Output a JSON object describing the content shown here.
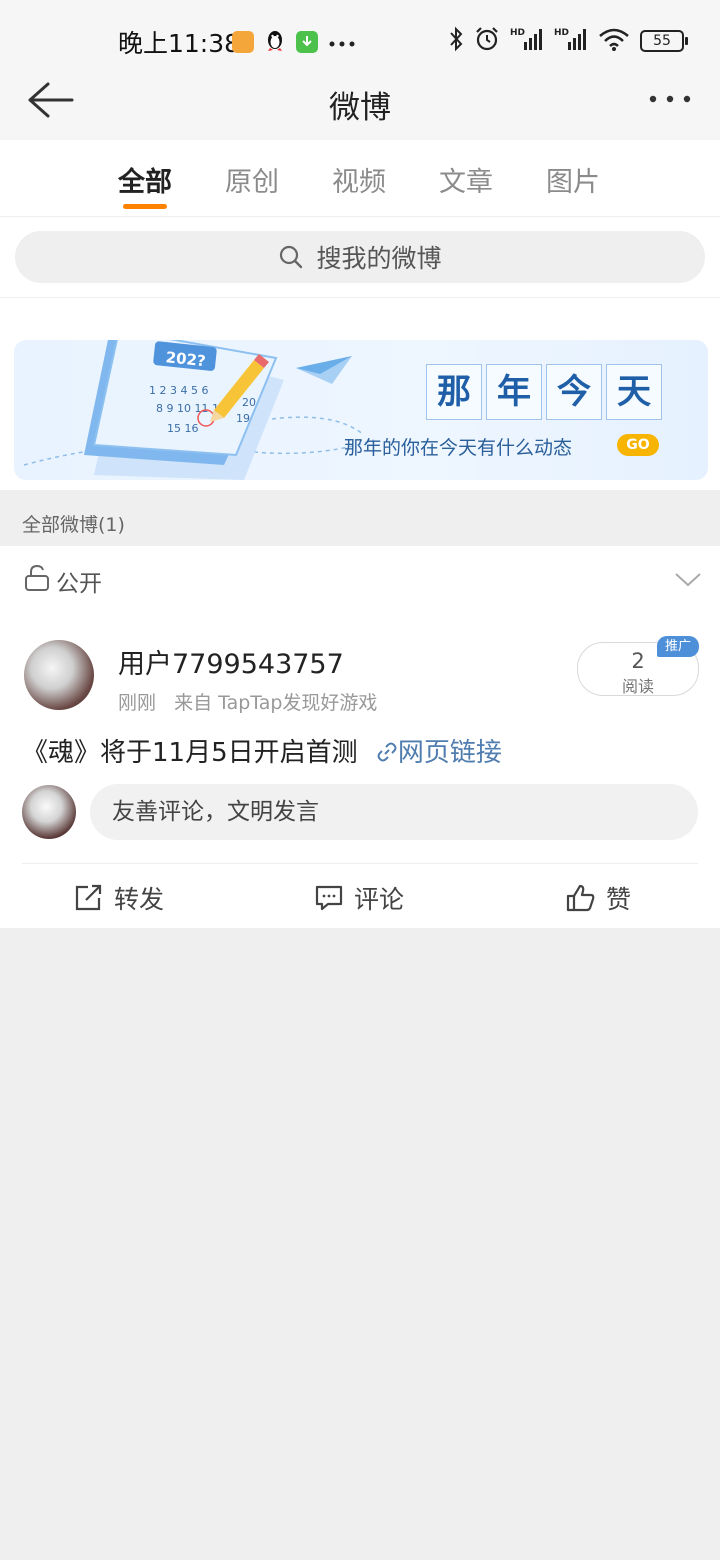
{
  "status_bar": {
    "time": "晚上11:38",
    "battery": "55"
  },
  "nav": {
    "title": "微博"
  },
  "tabs": [
    {
      "label": "全部",
      "active": true
    },
    {
      "label": "原创",
      "active": false
    },
    {
      "label": "视频",
      "active": false
    },
    {
      "label": "文章",
      "active": false
    },
    {
      "label": "图片",
      "active": false
    }
  ],
  "search": {
    "placeholder": "搜我的微博"
  },
  "banner": {
    "title_chars": [
      "那",
      "年",
      "今",
      "天"
    ],
    "subtitle": "那年的你在今天有什么动态",
    "go": "GO",
    "calendar_year": "202?"
  },
  "section": {
    "title": "全部微博(1)"
  },
  "filter": {
    "label": "公开"
  },
  "post": {
    "username": "用户7799543757",
    "time": "刚刚",
    "source": "来自 TapTap发现好游戏",
    "read_count": "2",
    "read_label": "阅读",
    "promo_badge": "推广",
    "text": "《魂》将于11月5日开启首测",
    "link_text": "网页链接",
    "comment_placeholder": "友善评论，文明发言"
  },
  "actions": {
    "repost": "转发",
    "comment": "评论",
    "like": "赞"
  },
  "colors": {
    "accent": "#ff8200",
    "link": "#507daf",
    "promo": "#4d8fd8",
    "go": "#f7b400"
  }
}
